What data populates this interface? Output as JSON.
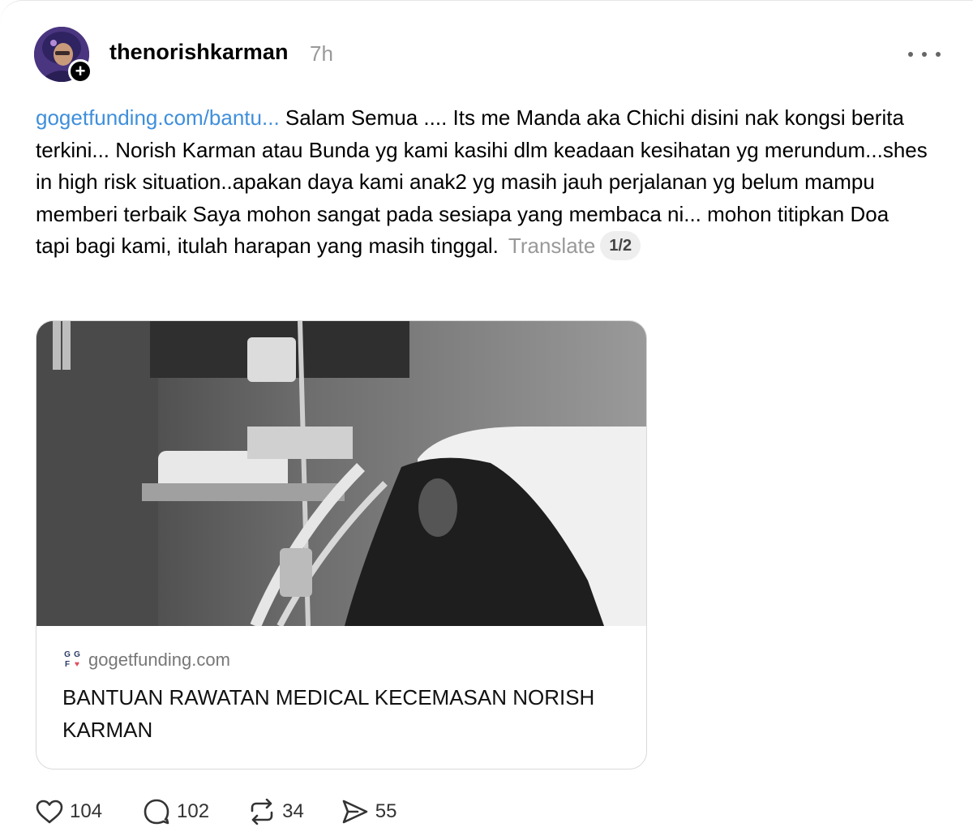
{
  "post": {
    "author": "thenorishkarman",
    "time": "7h",
    "link_text": "gogetfunding.com/bantu...",
    "body_text": " Salam Semua .... Its me Manda aka Chichi disini nak kongsi berita terkini... Norish Karman atau Bunda yg kami kasihi dlm keadaan kesihatan yg merundum...shes in high risk situation..apakan daya kami anak2 yg masih jauh perjalanan yg belum mampu memberi terbaik Saya mohon sangat pada sesiapa yang membaca ni... mohon titipkan Doa tapi bagi kami, itulah harapan yang masih tinggal.",
    "translate_label": "Translate",
    "page_indicator": "1/2"
  },
  "card": {
    "logo_letters": [
      "G",
      "G",
      "F",
      "♥"
    ],
    "domain": "gogetfunding.com",
    "title": "BANTUAN RAWATAN MEDICAL KECEMASAN NORISH KARMAN"
  },
  "actions": {
    "likes": "104",
    "replies": "102",
    "reposts": "34",
    "shares": "55"
  },
  "icons": {
    "more": "more-horizontal-icon",
    "follow": "plus-icon",
    "like": "heart-icon",
    "reply": "comment-icon",
    "repost": "repost-icon",
    "share": "send-icon"
  }
}
